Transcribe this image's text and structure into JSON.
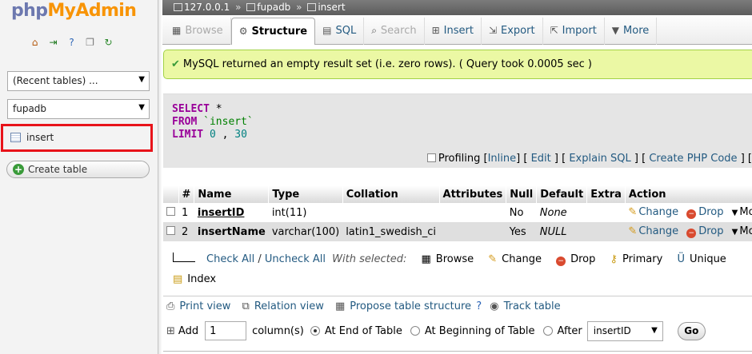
{
  "logo": {
    "php": "php",
    "my": "MyAdmin"
  },
  "sidebar": {
    "recent_tables": "(Recent tables) ...",
    "database": "fupadb",
    "table_item": "insert",
    "create_table": "Create table"
  },
  "breadcrumb": {
    "server": "127.0.0.1",
    "database": "fupadb",
    "table": "insert"
  },
  "tabs": [
    {
      "label": "Browse",
      "icon": "browse-icon",
      "state": "disabled"
    },
    {
      "label": "Structure",
      "icon": "structure-icon",
      "state": "active"
    },
    {
      "label": "SQL",
      "icon": "sql-icon",
      "state": "normal"
    },
    {
      "label": "Search",
      "icon": "search-icon",
      "state": "disabled"
    },
    {
      "label": "Insert",
      "icon": "insert-icon",
      "state": "normal"
    },
    {
      "label": "Export",
      "icon": "export-icon",
      "state": "normal"
    },
    {
      "label": "Import",
      "icon": "import-icon",
      "state": "normal"
    },
    {
      "label": "More",
      "icon": "more-icon",
      "state": "normal"
    }
  ],
  "message": "MySQL returned an empty result set (i.e. zero rows). ( Query took 0.0005 sec )",
  "sql": {
    "select_kw": "SELECT",
    "select_rest": "*",
    "from_kw": "FROM",
    "from_rest": "`insert`",
    "limit_kw": "LIMIT",
    "limit_start": "0",
    "limit_sep": ",",
    "limit_count": "30"
  },
  "sql_links": {
    "profiling": "Profiling",
    "inline": "Inline",
    "edit": "Edit",
    "explain": "Explain SQL",
    "create_php": "Create PHP Code",
    "lb": "[",
    "rb": "]"
  },
  "structure": {
    "headers": [
      "",
      "#",
      "Name",
      "Type",
      "Collation",
      "Attributes",
      "Null",
      "Default",
      "Extra",
      "Action"
    ],
    "rows": [
      {
        "num": "1",
        "name": "insertID",
        "type": "int(11)",
        "collation": "",
        "attributes": "",
        "null": "No",
        "default": "None",
        "extra": ""
      },
      {
        "num": "2",
        "name": "insertName",
        "type": "varchar(100)",
        "collation": "latin1_swedish_ci",
        "attributes": "",
        "null": "Yes",
        "default": "NULL",
        "extra": ""
      }
    ],
    "actions": {
      "change": "Change",
      "drop": "Drop",
      "more": "More"
    }
  },
  "bulk": {
    "check_all": "Check All",
    "slash": "/",
    "uncheck_all": "Uncheck All",
    "with_selected": "With selected:",
    "browse": "Browse",
    "change": "Change",
    "drop": "Drop",
    "primary": "Primary",
    "unique": "Unique",
    "index": "Index"
  },
  "tools": {
    "print_view": "Print view",
    "relation_view": "Relation view",
    "propose": "Propose table structure",
    "track": "Track table"
  },
  "add_column": {
    "add": "Add",
    "count": "1",
    "columns": "column(s)",
    "at_end": "At End of Table",
    "at_beginning": "At Beginning of Table",
    "after": "After",
    "after_column": "insertID",
    "go": "Go"
  }
}
